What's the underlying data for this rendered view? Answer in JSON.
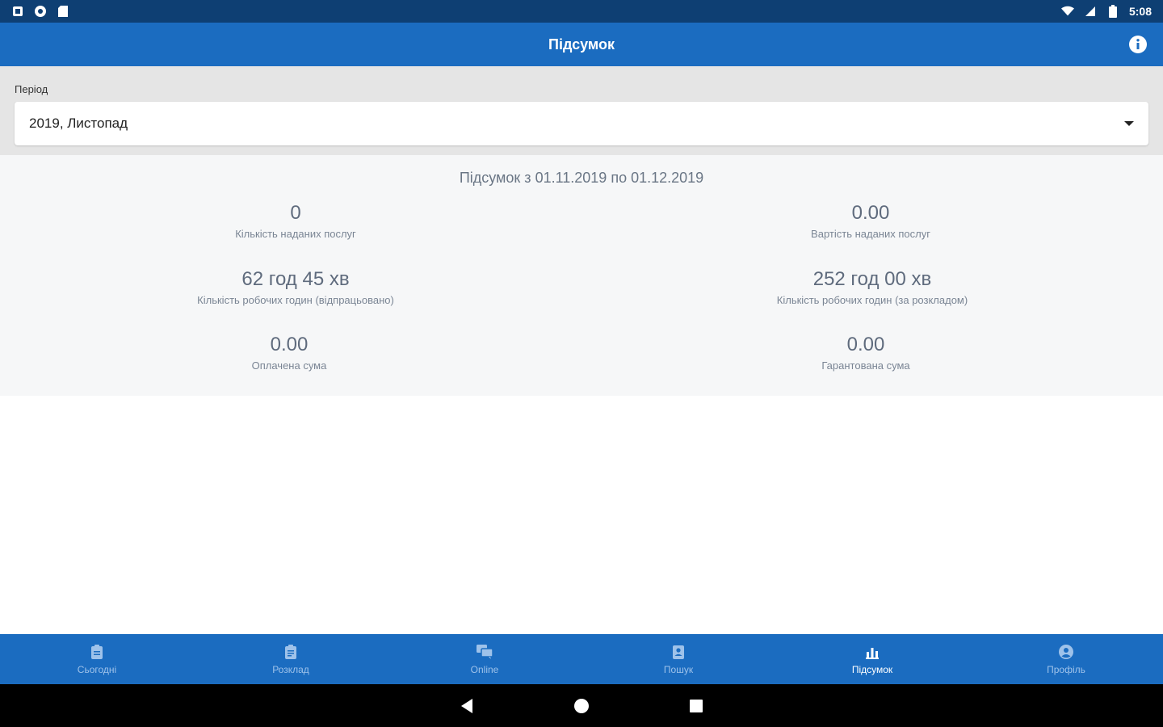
{
  "status_bar": {
    "time": "5:08"
  },
  "app_bar": {
    "title": "Підсумок"
  },
  "period": {
    "label": "Період",
    "selected": "2019, Листопад"
  },
  "summary": {
    "heading": "Підсумок з 01.11.2019 по 01.12.2019",
    "stats": [
      {
        "value": "0",
        "label": "Кількість наданих послуг"
      },
      {
        "value": "0.00",
        "label": "Вартість наданих послуг"
      },
      {
        "value": "62 год 45 хв",
        "label": "Кількість робочих годин (відпрацьовано)"
      },
      {
        "value": "252 год 00 хв",
        "label": "Кількість робочих годин (за розкладом)"
      },
      {
        "value": "0.00",
        "label": "Оплачена сума"
      },
      {
        "value": "0.00",
        "label": "Гарантована сума"
      }
    ]
  },
  "bottom_nav": {
    "items": [
      {
        "label": "Сьогодні",
        "icon": "clipboard-icon",
        "active": false
      },
      {
        "label": "Розклад",
        "icon": "calendar-icon",
        "active": false
      },
      {
        "label": "Online",
        "icon": "chat-icon",
        "active": false
      },
      {
        "label": "Пошук",
        "icon": "contact-search-icon",
        "active": false
      },
      {
        "label": "Підсумок",
        "icon": "bar-chart-icon",
        "active": true
      },
      {
        "label": "Профіль",
        "icon": "account-icon",
        "active": false
      }
    ]
  },
  "colors": {
    "status_bar": "#0e3f73",
    "primary": "#1b6cc0",
    "nav_inactive": "#9ec2ea",
    "text_muted": "#5f6b7d"
  }
}
